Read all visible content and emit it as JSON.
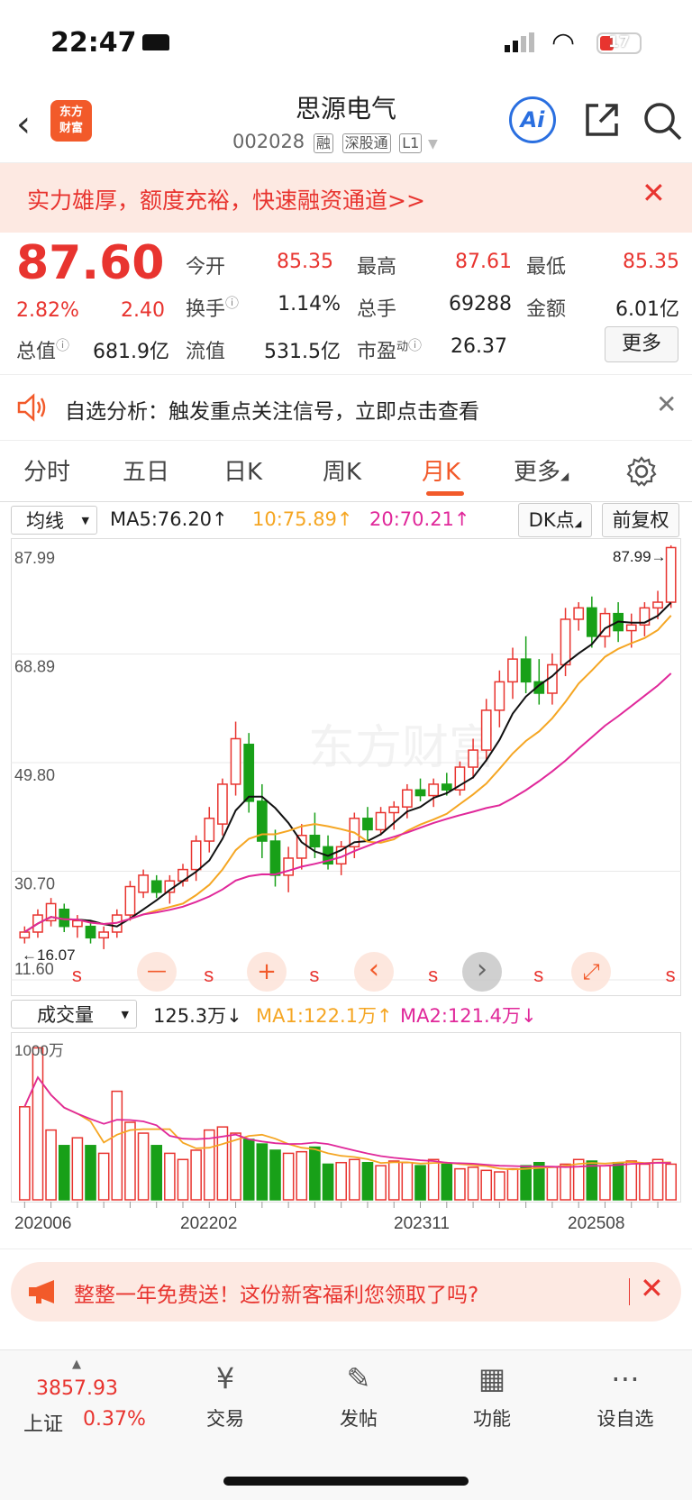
{
  "status_bar": {
    "time": "22:47",
    "battery": "17"
  },
  "header": {
    "back_label": "‹",
    "logo_text_1": "东方",
    "logo_text_2": "财富",
    "stock_name": "思源电气",
    "stock_code": "002028",
    "tags": [
      "融",
      "深股通",
      "L1"
    ],
    "ai_label": "Ai"
  },
  "banner": {
    "text": "实力雄厚，额度充裕，快速融资通道>>"
  },
  "quote": {
    "price": "87.60",
    "change_pct": "2.82%",
    "change": "2.40",
    "open_label": "今开",
    "open": "85.35",
    "high_label": "最高",
    "high": "87.61",
    "low_label": "最低",
    "low": "85.35",
    "turnover_label": "换手",
    "turnover": "1.14%",
    "volume_label": "总手",
    "volume": "69288",
    "amount_label": "金额",
    "amount": "6.01亿",
    "mcap_label": "总值",
    "mcap": "681.9亿",
    "float_label": "流值",
    "float": "531.5亿",
    "pe_label": "市盈",
    "pe_sup": "动",
    "pe": "26.37",
    "more_label": "更多"
  },
  "analysis": {
    "text": "自选分析：触发重点关注信号，立即点击查看"
  },
  "tabs": [
    "分时",
    "五日",
    "日K",
    "周K",
    "月K",
    "更多"
  ],
  "ma_row": {
    "selector": "均线",
    "ma5": "MA5:76.20↑",
    "ma10": "10:75.89↑",
    "ma20": "20:70.21↑",
    "dk_label": "DK点",
    "adjust_label": "前复权"
  },
  "chart_data": {
    "type": "candlestick",
    "price_axis_labels": [
      "87.99",
      "68.89",
      "49.80",
      "30.70",
      "11.60"
    ],
    "max_marker": "87.99→",
    "min_marker": "←16.07",
    "signal_marks": [
      "s",
      "s",
      "s",
      "s",
      "s",
      "s"
    ],
    "ohlc": [
      [
        19,
        21,
        18,
        20
      ],
      [
        20,
        24,
        19,
        23
      ],
      [
        22,
        26,
        21,
        25
      ],
      [
        24,
        25,
        20,
        21
      ],
      [
        21,
        23,
        19,
        22
      ],
      [
        21,
        22,
        18,
        19
      ],
      [
        19,
        21,
        17,
        20
      ],
      [
        20,
        24,
        19,
        23
      ],
      [
        23,
        29,
        22,
        28
      ],
      [
        27,
        31,
        26,
        30
      ],
      [
        29,
        30,
        26,
        27
      ],
      [
        27,
        30,
        25,
        29
      ],
      [
        29,
        32,
        28,
        31
      ],
      [
        31,
        37,
        29,
        36
      ],
      [
        36,
        42,
        34,
        40
      ],
      [
        39,
        47,
        37,
        46
      ],
      [
        46,
        57,
        44,
        54
      ],
      [
        53,
        55,
        41,
        43
      ],
      [
        43,
        46,
        33,
        36
      ],
      [
        36,
        38,
        28,
        30
      ],
      [
        30,
        35,
        27,
        33
      ],
      [
        33,
        39,
        31,
        37
      ],
      [
        37,
        41,
        33,
        35
      ],
      [
        35,
        37,
        31,
        32
      ],
      [
        32,
        36,
        30,
        35
      ],
      [
        35,
        41,
        33,
        40
      ],
      [
        40,
        42,
        36,
        38
      ],
      [
        38,
        42,
        37,
        41
      ],
      [
        41,
        43,
        38,
        42
      ],
      [
        42,
        46,
        40,
        45
      ],
      [
        45,
        47,
        43,
        44
      ],
      [
        44,
        47,
        42,
        46
      ],
      [
        46,
        48,
        44,
        45
      ],
      [
        45,
        50,
        44,
        49
      ],
      [
        49,
        54,
        47,
        52
      ],
      [
        52,
        61,
        50,
        59
      ],
      [
        59,
        66,
        56,
        64
      ],
      [
        64,
        70,
        61,
        68
      ],
      [
        68,
        72,
        62,
        64
      ],
      [
        64,
        68,
        60,
        62
      ],
      [
        62,
        69,
        60,
        67
      ],
      [
        67,
        77,
        65,
        75
      ],
      [
        75,
        78,
        73,
        77
      ],
      [
        77,
        79,
        70,
        72
      ],
      [
        72,
        77,
        70,
        76
      ],
      [
        76,
        78,
        71,
        73
      ],
      [
        73,
        76,
        70,
        74
      ],
      [
        74,
        78,
        72,
        77
      ],
      [
        77,
        80,
        75,
        78
      ],
      [
        78,
        88,
        77,
        87.6
      ]
    ],
    "volume_axis_label": "1000万",
    "volume_values": [
      6,
      9.8,
      4.5,
      3.5,
      4,
      3.5,
      3,
      7,
      5,
      4.3,
      3.5,
      3,
      2.6,
      3.2,
      4.5,
      4.7,
      4.3,
      3.9,
      3.6,
      3.2,
      3,
      3.1,
      3.4,
      2.3,
      2.4,
      2.6,
      2.4,
      2.2,
      2.5,
      2.4,
      2.2,
      2.6,
      2.3,
      2.0,
      2.1,
      1.9,
      1.8,
      2.0,
      2.2,
      2.4,
      2.1,
      2.3,
      2.6,
      2.5,
      2.2,
      2.4,
      2.5,
      2.3,
      2.6,
      2.3
    ],
    "volume_colors": "alternating",
    "x_labels": [
      "202006",
      "202202",
      "202311",
      "202508"
    ]
  },
  "chart_controls": {
    "minus": "—",
    "plus": "+",
    "prev": "‹",
    "next": "›",
    "expand": "⤢"
  },
  "volume_row": {
    "selector": "成交量",
    "vol": "125.3万↓",
    "ma1": "MA1:122.1万↑",
    "ma2": "MA2:121.4万↓"
  },
  "promo": {
    "text": "整整一年免费送！这份新客福利您领取了吗?"
  },
  "bottom_nav": {
    "index_value": "3857.93",
    "index_name": "上证",
    "index_change": "0.37%",
    "items": [
      {
        "label": "交易"
      },
      {
        "label": "发帖"
      },
      {
        "label": "功能"
      },
      {
        "label": "设自选"
      }
    ]
  },
  "colors": {
    "up": "#e8342f",
    "down": "#18a018",
    "accent": "#f25a2a",
    "ma5": "#111111",
    "ma10": "#f5a623",
    "ma20": "#e0289a"
  }
}
